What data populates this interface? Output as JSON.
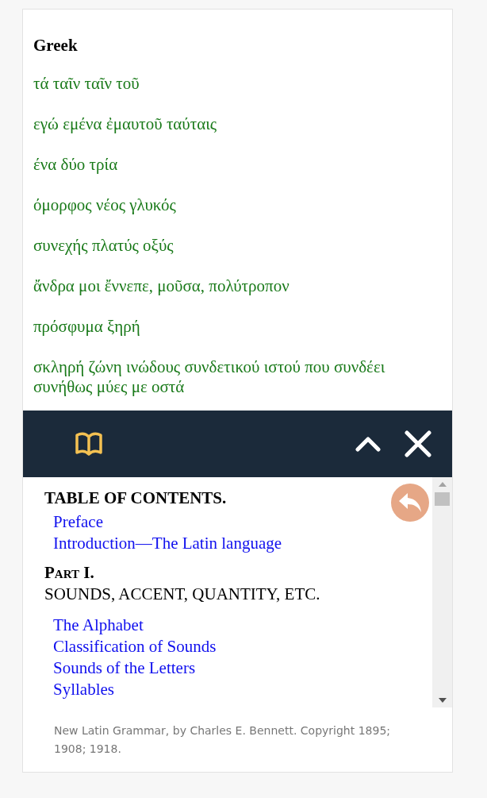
{
  "section": {
    "heading": "Greek",
    "lines": [
      "τά ταῖν ταῖν τοῦ",
      "εγώ εμένα ἐμαυτοῦ ταύταις",
      "ένα δύο τρία",
      "όμορφος νέος γλυκός",
      "συνεχής πλατύς οξύς",
      "ἄνδρα μοι ἔννεπε, μοῦσα, πολύτροπον",
      "πρόσφυμα ξηρή",
      "σκληρή ζώνη ινώδους συνδετικού ιστού που συνδέει συνήθως μύες με οστά"
    ]
  },
  "viewer": {
    "contents": [
      {
        "kind": "title",
        "text": "TABLE OF CONTENTS."
      },
      {
        "kind": "link",
        "text": "Preface"
      },
      {
        "kind": "link",
        "text": "Introduction—The Latin language"
      },
      {
        "kind": "part",
        "text": "Part I."
      },
      {
        "kind": "subtitle",
        "text": "SOUNDS, ACCENT, QUANTITY, ETC."
      },
      {
        "kind": "link",
        "text": "The Alphabet"
      },
      {
        "kind": "link",
        "text": "Classification of Sounds"
      },
      {
        "kind": "link",
        "text": "Sounds of the Letters"
      },
      {
        "kind": "link",
        "text": "Syllables"
      }
    ],
    "credit": "New Latin Grammar, by Charles E. Bennett. Copyright 1895; 1908; 1918."
  }
}
